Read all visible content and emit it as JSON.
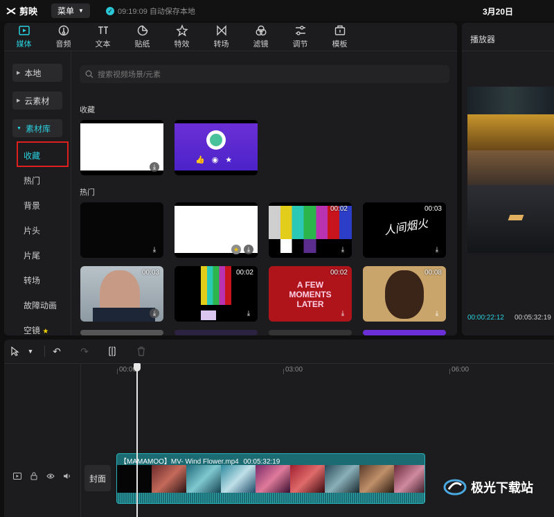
{
  "titlebar": {
    "app_name": "剪映",
    "menu_label": "菜单",
    "autosave_text": "09:19:09 自动保存本地",
    "date": "3月20日"
  },
  "toolbar": {
    "tools": [
      {
        "label": "媒体",
        "icon": "media-icon"
      },
      {
        "label": "音频",
        "icon": "audio-icon"
      },
      {
        "label": "文本",
        "icon": "text-icon"
      },
      {
        "label": "贴纸",
        "icon": "sticker-icon"
      },
      {
        "label": "特效",
        "icon": "effects-icon"
      },
      {
        "label": "转场",
        "icon": "transition-icon"
      },
      {
        "label": "滤镜",
        "icon": "filter-icon"
      },
      {
        "label": "调节",
        "icon": "adjust-icon"
      },
      {
        "label": "模板",
        "icon": "template-icon"
      }
    ],
    "active": "媒体"
  },
  "sidebar": {
    "groups": [
      "本地",
      "云素材",
      "素材库"
    ],
    "items": [
      "收藏",
      "热门",
      "背景",
      "片头",
      "片尾",
      "转场",
      "故障动画",
      "空镜"
    ],
    "active_item": "收藏"
  },
  "search": {
    "placeholder": "搜索视频场景/元素"
  },
  "sections": {
    "favorites_label": "收藏",
    "popular_label": "热门"
  },
  "thumbs": {
    "popular": [
      {
        "duration": ""
      },
      {
        "duration": ""
      },
      {
        "duration": "00:02"
      },
      {
        "duration": "00:03"
      },
      {
        "duration": "00:03"
      },
      {
        "duration": "00:02"
      },
      {
        "duration": "00:02"
      },
      {
        "duration": "00:08"
      }
    ],
    "overlay_texts": {
      "calligraphy": "人间烟火",
      "few_moments": "A FEW MOMENTS LATER"
    }
  },
  "player": {
    "title": "播放器",
    "current_time": "00:00:22:12",
    "total_time": "00:05:32:19"
  },
  "timeline": {
    "ruler": [
      "00:00",
      "03:00",
      "06:00"
    ],
    "cover_label": "封面",
    "clip_title": "【MAMAMOO】MV- Wind Flower.mp4",
    "clip_duration": "00:05:32:19"
  },
  "watermark": {
    "text": "极光下载站"
  },
  "colors": {
    "accent": "#2ad1df",
    "highlight_box": "#e01e1e",
    "clip": "#1b6b73"
  }
}
